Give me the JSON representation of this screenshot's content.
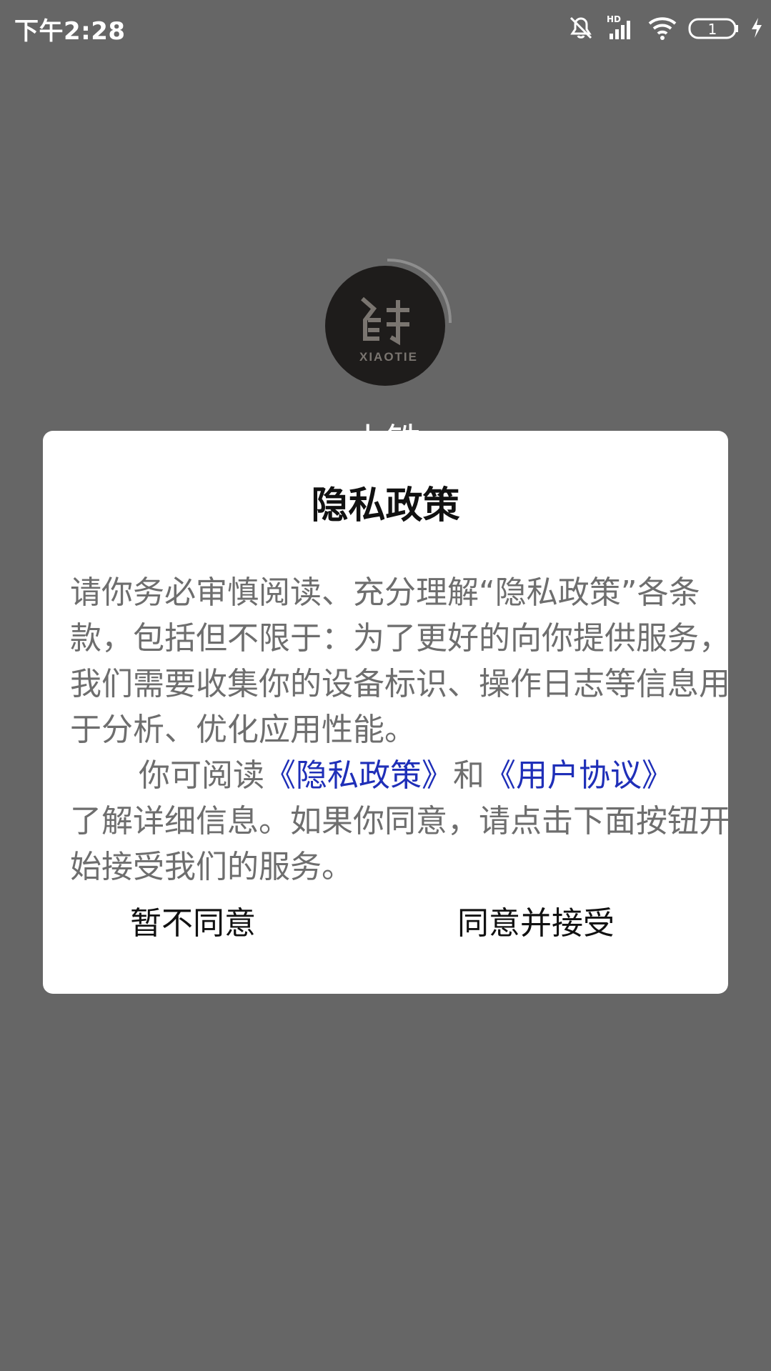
{
  "status_bar": {
    "time": "下午2:28",
    "network_type": "HD",
    "battery_level": "1",
    "icons": [
      "mute-icon",
      "signal-icon",
      "wifi-icon",
      "battery-icon",
      "charging-icon"
    ]
  },
  "background": {
    "logo_text": "XIAOTIE",
    "app_name": "小铁"
  },
  "dialog": {
    "title": "隐私政策",
    "paragraph1": "请你务必审慎阅读、充分理解“隐私政策”各条款，包括但不限于：为了更好的向你提供服务，我们需要收集你的设备标识、操作日志等信息用于分析、优化应用性能。",
    "paragraph2_prefix": "你可阅读",
    "privacy_link": "《隐私政策》",
    "conjunction": "和",
    "terms_link": "《用户协议》",
    "paragraph2_suffix": "了解详细信息。如果你同意，请点击下面按钮开始接受我们的服务。",
    "disagree_label": "暂不同意",
    "agree_label": "同意并接受"
  },
  "colors": {
    "overlay": "#666666",
    "link": "#1f2fb8",
    "body_text": "#6e6e6e"
  }
}
